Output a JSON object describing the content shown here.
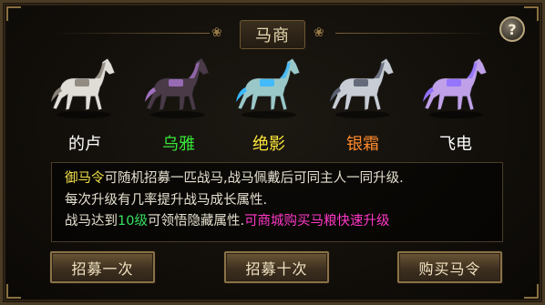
{
  "title": "马商",
  "help_label": "?",
  "horses": [
    {
      "name": "的卢",
      "color": "#ffffff",
      "icon": "white-horse-icon",
      "body": "#e0ddd6",
      "accent": "#8a8278"
    },
    {
      "name": "乌雅",
      "color": "#38e83a",
      "icon": "black-horse-icon",
      "body": "#4a3a48",
      "accent": "#a070c0"
    },
    {
      "name": "绝影",
      "color": "#ffe83a",
      "icon": "blue-armored-horse-icon",
      "body": "#9ac8c8",
      "accent": "#3ab8ff"
    },
    {
      "name": "银霜",
      "color": "#ff8a2a",
      "icon": "silver-armored-horse-icon",
      "body": "#c8ccd4",
      "accent": "#5a6070"
    },
    {
      "name": "飞电",
      "color": "#ffffff",
      "icon": "purple-spectral-horse-icon",
      "body": "#c0a0e8",
      "accent": "#9070ff"
    }
  ],
  "info": {
    "line1_highlight": "御马令",
    "line1_rest": "可随机招募一匹战马,战马佩戴后可同主人一同升级.",
    "line2": "每次升级有几率提升战马成长属性.",
    "line3_pre": "战马达到",
    "line3_level": "10级",
    "line3_mid": "可领悟隐藏属性.",
    "line3_promo": "可商城购买马粮快速升级"
  },
  "buttons": {
    "recruit_once": "招募一次",
    "recruit_ten": "招募十次",
    "buy_token": "购买马令"
  }
}
